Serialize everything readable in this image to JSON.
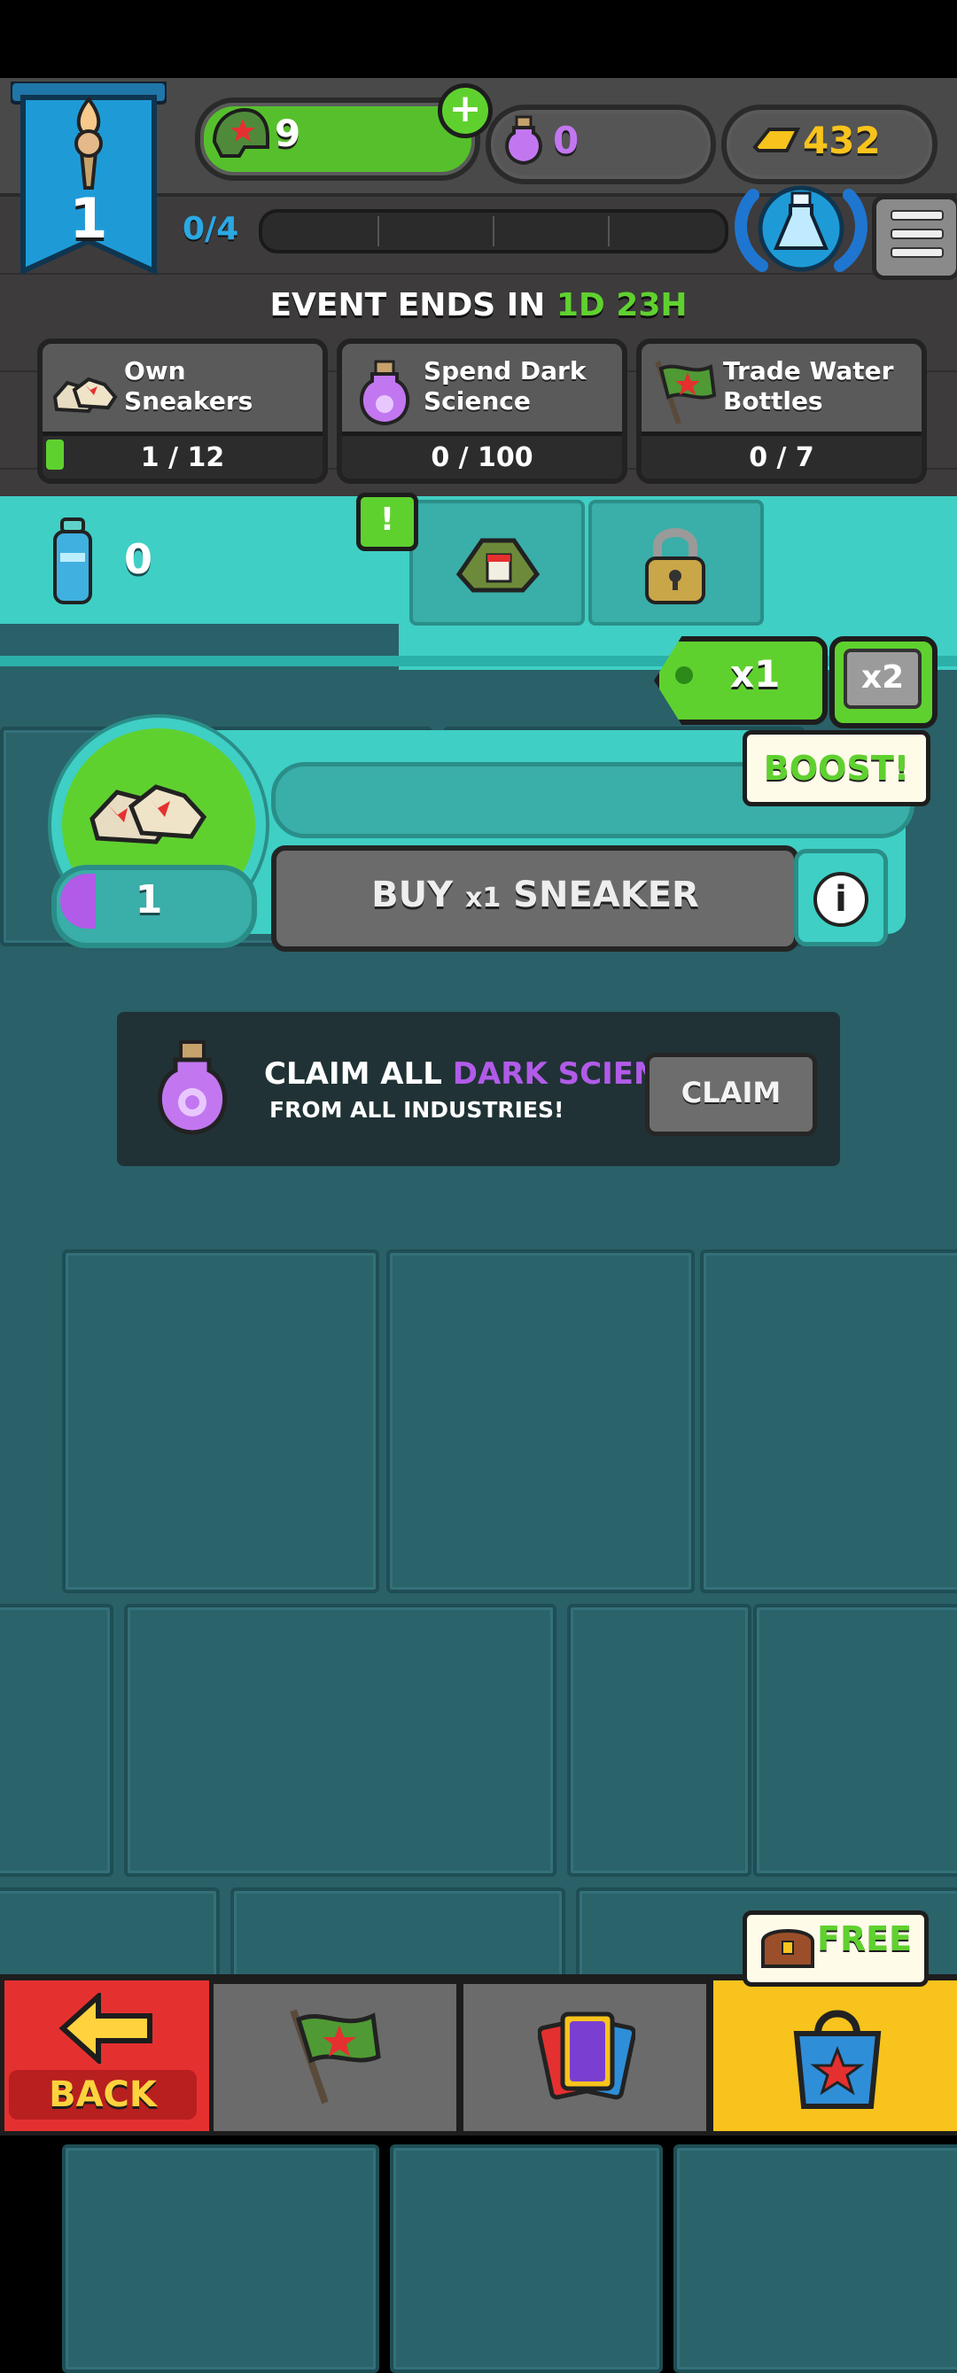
{
  "header": {
    "level": "1",
    "helmets": "9",
    "dark_science": "0",
    "gold": "432",
    "progress": "0/4",
    "progress_fraction": 0.0
  },
  "event": {
    "label": "EVENT ENDS IN",
    "time": "1D 23H",
    "tasks": [
      {
        "title_line1": "Own",
        "title_line2": "Sneakers",
        "count": "1 / 12",
        "progress_fraction": 0.083,
        "icon": "sneakers-icon"
      },
      {
        "title_line1": "Spend Dark",
        "title_line2": "Science",
        "count": "0 / 100",
        "progress_fraction": 0.0,
        "icon": "dark-science-flask-icon"
      },
      {
        "title_line1": "Trade Water",
        "title_line2": "Bottles",
        "count": "0 / 7",
        "progress_fraction": 0.0,
        "icon": "flag-icon"
      }
    ]
  },
  "resource": {
    "water_bottles": "0",
    "alert": "!"
  },
  "multiplier": {
    "x1": "x1",
    "x2": "x2",
    "boost": "BOOST!"
  },
  "industry": {
    "owned": "1",
    "buy_label_pre": "BUY ",
    "buy_label_mult": "x1",
    "buy_label_post": " SNEAKER",
    "info": "i"
  },
  "claim": {
    "line1_pre": "CLAIM ALL ",
    "line1_highlight": "DARK SCIENCE",
    "line2": "FROM ALL INDUSTRIES!",
    "button": "CLAIM"
  },
  "nav": {
    "back": "BACK",
    "free": "FREE"
  },
  "colors": {
    "accent_green": "#5fd12f",
    "teal": "#3fcfc5",
    "dark_science_purple": "#b15be8",
    "back_red": "#e53030",
    "shop_yellow": "#f8c31c"
  }
}
